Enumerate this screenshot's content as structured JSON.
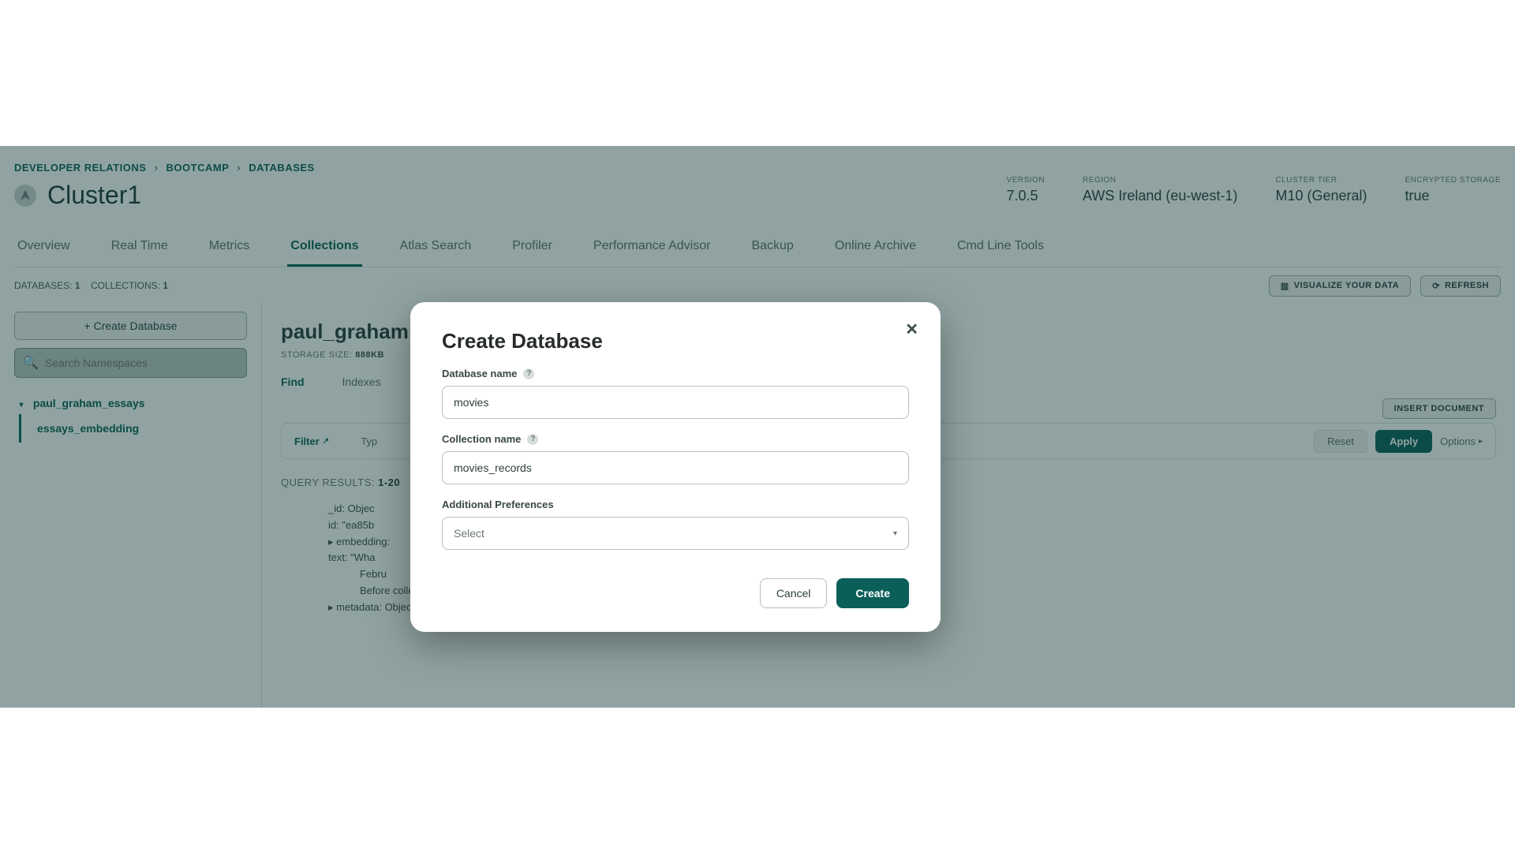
{
  "breadcrumb": {
    "a": "DEVELOPER RELATIONS",
    "b": "BOOTCAMP",
    "c": "DATABASES"
  },
  "cluster": {
    "name": "Cluster1"
  },
  "stats": {
    "version_label": "VERSION",
    "version_value": "7.0.5",
    "region_label": "REGION",
    "region_value": "AWS Ireland (eu-west-1)",
    "tier_label": "CLUSTER TIER",
    "tier_value": "M10 (General)",
    "enc_label": "ENCRYPTED STORAGE",
    "enc_value": "true"
  },
  "tabs": {
    "overview": "Overview",
    "realtime": "Real Time",
    "metrics": "Metrics",
    "collections": "Collections",
    "search": "Atlas Search",
    "profiler": "Profiler",
    "perf": "Performance Advisor",
    "backup": "Backup",
    "archive": "Online Archive",
    "cli": "Cmd Line Tools"
  },
  "metabar": {
    "databases_label": "DATABASES:",
    "databases_count": "1",
    "collections_label": "COLLECTIONS:",
    "collections_count": "1",
    "visualize": "VISUALIZE YOUR DATA",
    "refresh": "REFRESH"
  },
  "sidebar": {
    "create_btn": "+  Create Database",
    "search_placeholder": "Search Namespaces",
    "db_name": "paul_graham_essays",
    "coll_name": "essays_embedding"
  },
  "main": {
    "title": "paul_graham",
    "storage_label": "STORAGE SIZE:",
    "storage_value": "888KB",
    "subtab_find": "Find",
    "subtab_indexes": "Indexes",
    "insert_doc": "INSERT DOCUMENT",
    "filter_label": "Filter",
    "filter_type": "Typ",
    "reset": "Reset",
    "apply": "Apply",
    "options": "Options",
    "query_results_label": "QUERY RESULTS:",
    "query_results_range": "1-20"
  },
  "doc": {
    "l1": "_id: Objec",
    "l2": "id: \"ea85b",
    "l3": "▸ embedding:",
    "l4": "text: \"Wha",
    "l5": "Febru",
    "l6": "Before college the two main things I …\"",
    "l7": "▸ metadata: Object"
  },
  "modal": {
    "title": "Create Database",
    "db_label": "Database name",
    "db_value": "movies",
    "coll_label": "Collection name",
    "coll_value": "movies_records",
    "prefs_label": "Additional Preferences",
    "select_placeholder": "Select",
    "cancel": "Cancel",
    "create": "Create"
  }
}
